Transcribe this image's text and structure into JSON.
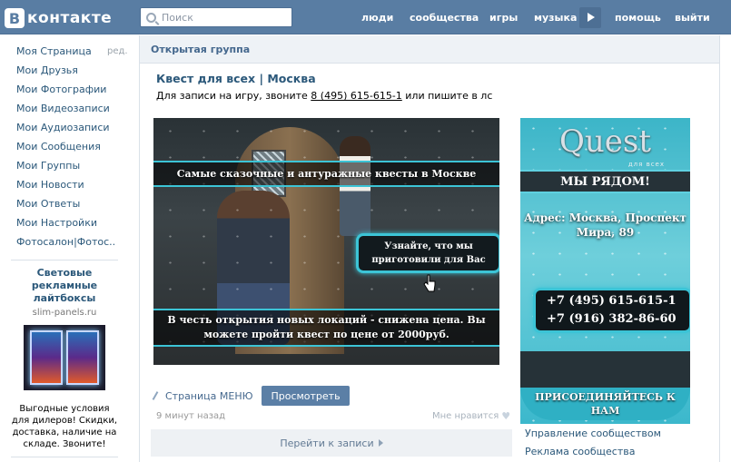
{
  "header": {
    "logo_letter": "В",
    "logo_text": "контакте",
    "search_placeholder": "Поиск",
    "nav": [
      "люди",
      "сообщества",
      "игры",
      "музыка",
      "помощь",
      "выйти"
    ]
  },
  "left_menu": {
    "items": [
      "Моя Страница",
      "Мои Друзья",
      "Мои Фотографии",
      "Мои Видеозаписи",
      "Мои Аудиозаписи",
      "Мои Сообщения",
      "Мои Группы",
      "Мои Новости",
      "Мои Ответы",
      "Мои Настройки",
      "Фотосалон|Фотос.."
    ],
    "edit_label": "ред."
  },
  "ad": {
    "title": "Световые рекламные лайтбоксы",
    "domain": "slim-panels.ru",
    "text": "Выгодные условия для дилеров! Скидки, доставка, наличие на складе. Звоните!"
  },
  "main": {
    "header": "Открытая группа",
    "group_name": "Квест для всех | Москва",
    "status_prefix": "Для записи на игру, звоните ",
    "status_phone": "8 (495) 615-615-1",
    "status_suffix": " или пишите в лс",
    "banner": {
      "band1": "Самые сказочные и антуражные квесты в Москве",
      "cta": "Узнайте, что мы приготовили для Вас",
      "band2": "В честь открытия новых локаций - снижена цена. Вы можете пройти квест по цене от 2000руб."
    },
    "menu_link": "Страница МЕНЮ",
    "view_button": "Просмотреть",
    "time": "9 минут назад",
    "like": "Мне нравится",
    "goto": "Перейти к записи"
  },
  "side_banner": {
    "logo": "Quest",
    "logo_sub": "для всех",
    "near": "МЫ РЯДОМ!",
    "address": "Адрес: Москва, Проспект Мира, 89",
    "phone1": "+7 (495) 615-615-1",
    "phone2": "+7 (916) 382-86-60",
    "join": "ПРИСОЕДИНЯЙТЕСЬ К НАМ"
  },
  "right_links": [
    "Управление сообществом",
    "Реклама сообщества"
  ],
  "colors": {
    "header": "#597da3",
    "link": "#2b587a",
    "accent": "#3cc4d6"
  }
}
